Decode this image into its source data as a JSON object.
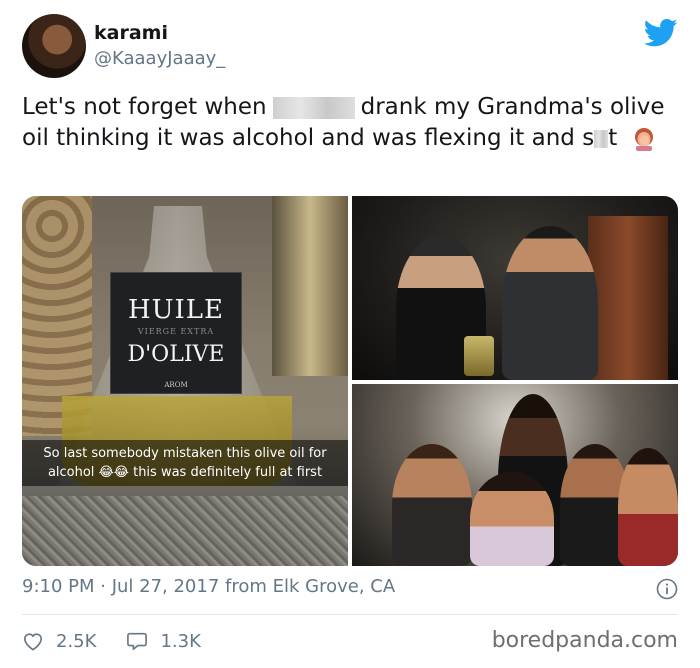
{
  "header": {
    "display_name": "karami",
    "handle": "@KaaayJaaay_",
    "twitter_blue": "#1da1f2"
  },
  "tweet": {
    "text_part1": "Let's not forget when",
    "text_part2": "drank my Grandma's olive oil thinking it was alcohol and was flexing it and",
    "text_part3": "s",
    "text_part4": "t",
    "emoji": "woman-facepalming"
  },
  "media": {
    "bottle_label": {
      "line1": "HUILE",
      "line2": "VIERGE EXTRA",
      "line3": "D'OLIVE",
      "line4": "AROM"
    },
    "caption": {
      "line1": "So last somebody mistaken this olive oil for",
      "line2a": "alcohol",
      "line2_emoji": "😂😂",
      "line2b": "this was definitely full at first"
    }
  },
  "meta": {
    "timestamp": "9:10 PM · Jul 27, 2017 from Elk Grove, CA"
  },
  "actions": {
    "likes": "2.5K",
    "replies": "1.3K"
  },
  "watermark": "boredpanda.com"
}
